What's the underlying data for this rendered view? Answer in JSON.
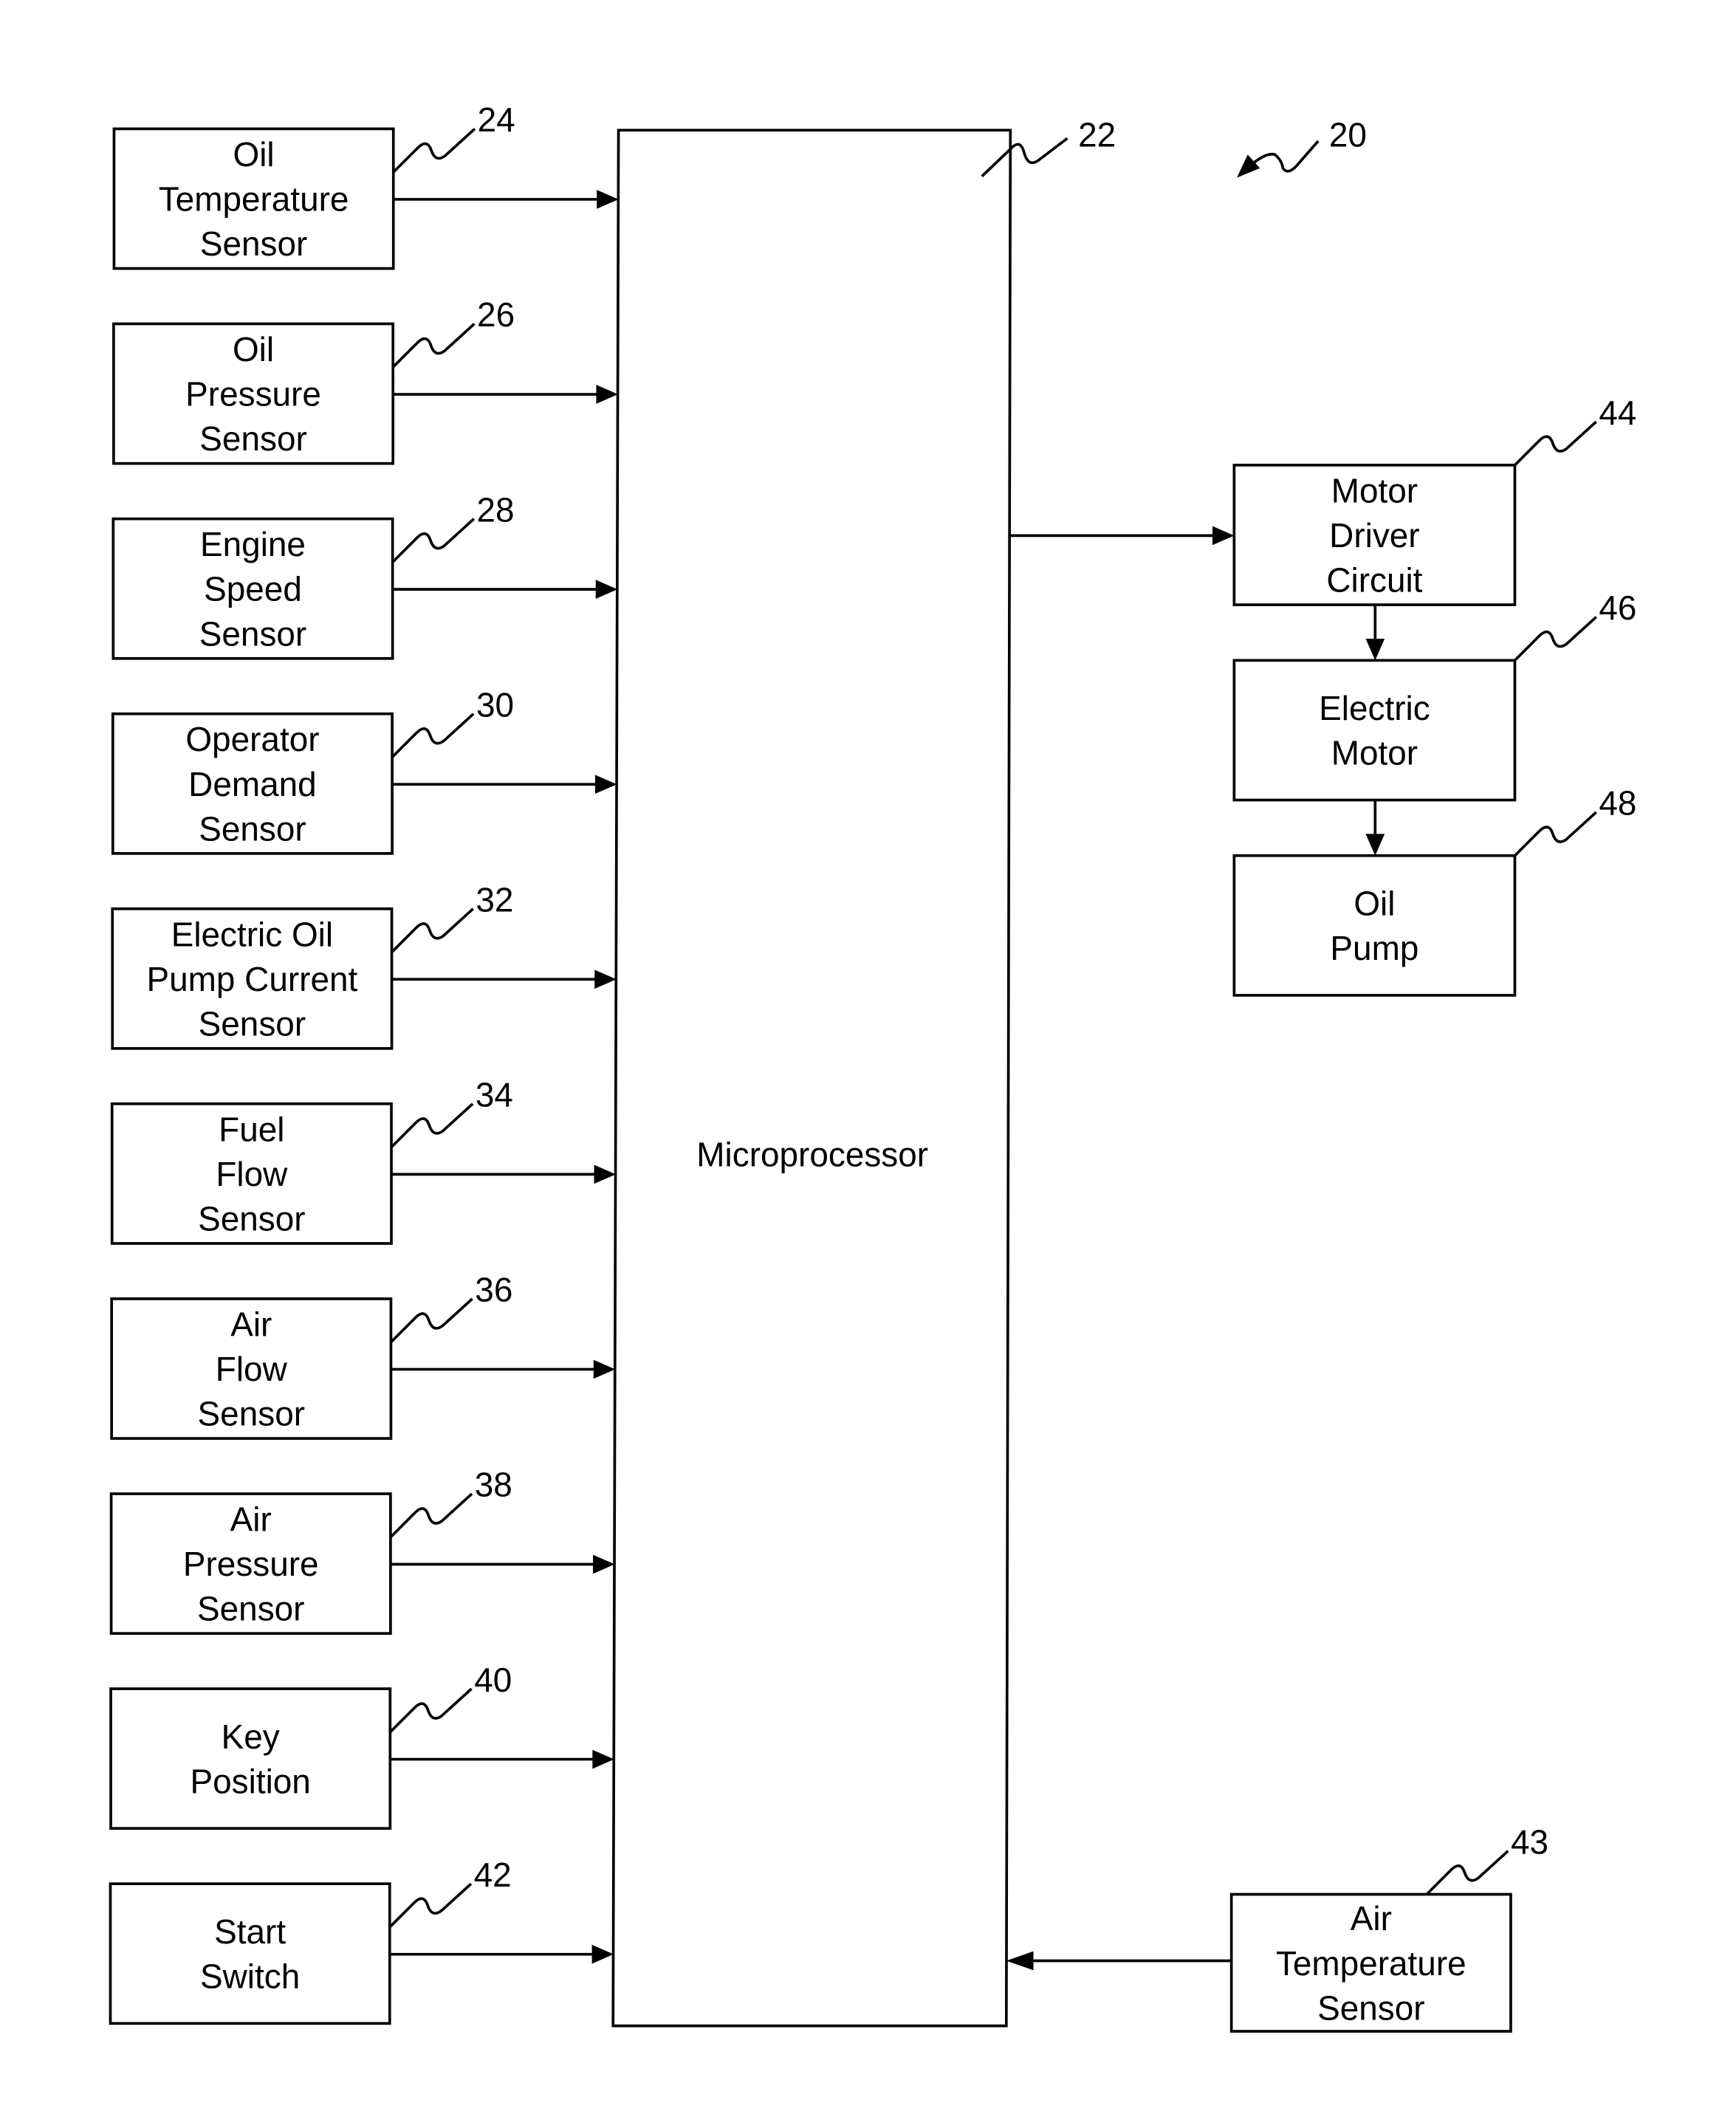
{
  "figure": {
    "overall_ref": "20",
    "microprocessor": {
      "ref": "22",
      "label": "Microprocessor"
    },
    "inputs": [
      {
        "ref": "24",
        "lines": [
          "Oil",
          "Temperature",
          "Sensor"
        ]
      },
      {
        "ref": "26",
        "lines": [
          "Oil",
          "Pressure",
          "Sensor"
        ]
      },
      {
        "ref": "28",
        "lines": [
          "Engine",
          "Speed",
          "Sensor"
        ]
      },
      {
        "ref": "30",
        "lines": [
          "Operator",
          "Demand",
          "Sensor"
        ]
      },
      {
        "ref": "32",
        "lines": [
          "Electric Oil",
          "Pump Current",
          "Sensor"
        ]
      },
      {
        "ref": "34",
        "lines": [
          "Fuel",
          "Flow",
          "Sensor"
        ]
      },
      {
        "ref": "36",
        "lines": [
          "Air",
          "Flow",
          "Sensor"
        ]
      },
      {
        "ref": "38",
        "lines": [
          "Air",
          "Pressure",
          "Sensor"
        ]
      },
      {
        "ref": "40",
        "lines": [
          "Key",
          "Position"
        ]
      },
      {
        "ref": "42",
        "lines": [
          "Start",
          "Switch"
        ]
      }
    ],
    "outputs": [
      {
        "ref": "44",
        "lines": [
          "Motor",
          "Driver",
          "Circuit"
        ]
      },
      {
        "ref": "46",
        "lines": [
          "Electric",
          "Motor"
        ]
      },
      {
        "ref": "48",
        "lines": [
          "Oil",
          "Pump"
        ]
      }
    ],
    "right_input": {
      "ref": "43",
      "lines": [
        "Air",
        "Temperature",
        "Sensor"
      ]
    }
  }
}
